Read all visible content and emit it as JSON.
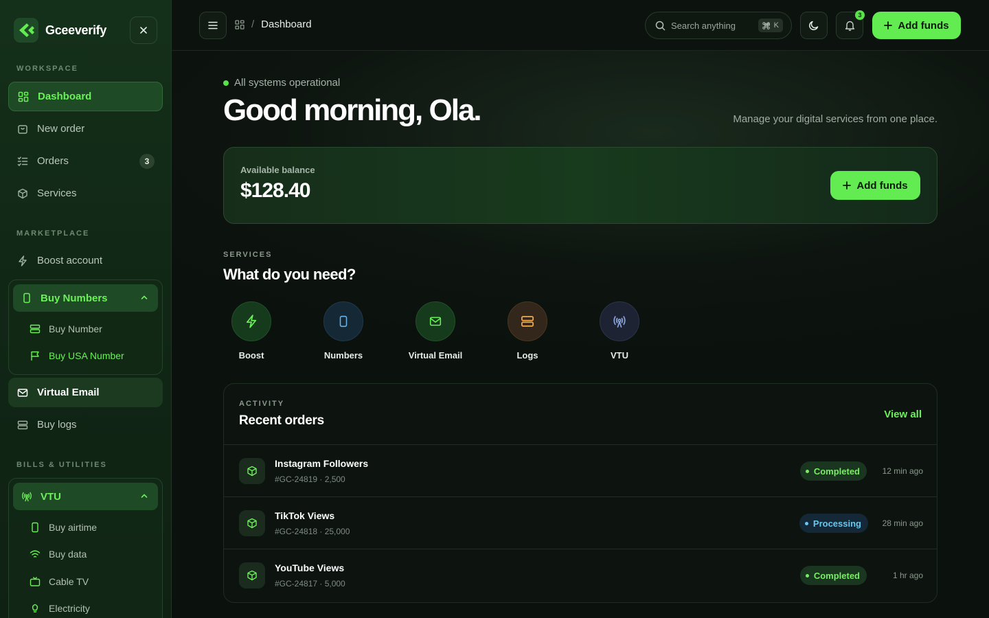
{
  "brand": {
    "name": "Gceeverify"
  },
  "sidebar": {
    "workspace_label": "WORKSPACE",
    "workspace_items": [
      {
        "label": "Dashboard"
      },
      {
        "label": "New order"
      },
      {
        "label": "Orders",
        "badge": "3"
      },
      {
        "label": "Services"
      }
    ],
    "marketplace_label": "MARKETPLACE",
    "boost_label": "Boost account",
    "buy_numbers": {
      "label": "Buy Numbers",
      "items": [
        {
          "label": "Buy Number"
        },
        {
          "label": "Buy USA Number"
        }
      ]
    },
    "virtual_email_label": "Virtual Email",
    "buy_logs_label": "Buy logs",
    "bills_label": "BILLS & UTILITIES",
    "vtu": {
      "label": "VTU",
      "items": [
        {
          "label": "Buy airtime"
        },
        {
          "label": "Buy data"
        },
        {
          "label": "Cable TV"
        },
        {
          "label": "Electricity"
        }
      ]
    }
  },
  "topbar": {
    "breadcrumb": "Dashboard",
    "breadcrumb_sep": "/",
    "search_placeholder": "Search anything",
    "shortcut_key": "K",
    "notification_count": "3",
    "add_funds_label": "Add funds"
  },
  "main": {
    "status": "All systems operational",
    "greeting": "Good morning, Ola.",
    "tagline": "Manage your digital services from one place.",
    "balance": {
      "label": "Available balance",
      "amount": "$128.40",
      "button_label": "Add funds"
    },
    "services": {
      "eyebrow": "SERVICES",
      "title": "What do you need?",
      "items": [
        {
          "label": "Boost",
          "icon": "bolt-icon"
        },
        {
          "label": "Numbers",
          "icon": "phone-icon"
        },
        {
          "label": "Virtual Email",
          "icon": "mail-icon"
        },
        {
          "label": "Logs",
          "icon": "server-icon"
        },
        {
          "label": "VTU",
          "icon": "signal-icon"
        }
      ]
    },
    "activity": {
      "eyebrow": "ACTIVITY",
      "title": "Recent orders",
      "view_all": "View all",
      "orders": [
        {
          "title": "Instagram Followers",
          "meta": "#GC-24819 · 2,500",
          "status": "Completed",
          "time": "12 min ago"
        },
        {
          "title": "TikTok Views",
          "meta": "#GC-24818 · 25,000",
          "status": "Processing",
          "time": "28 min ago"
        },
        {
          "title": "YouTube Views",
          "meta": "#GC-24817 · 5,000",
          "status": "Completed",
          "time": "1 hr ago"
        }
      ]
    }
  },
  "colors": {
    "accent": "#62ec52",
    "sidebar_bg": "#14301a",
    "page_bg": "#0b110d",
    "processing": "#68c8ee"
  }
}
